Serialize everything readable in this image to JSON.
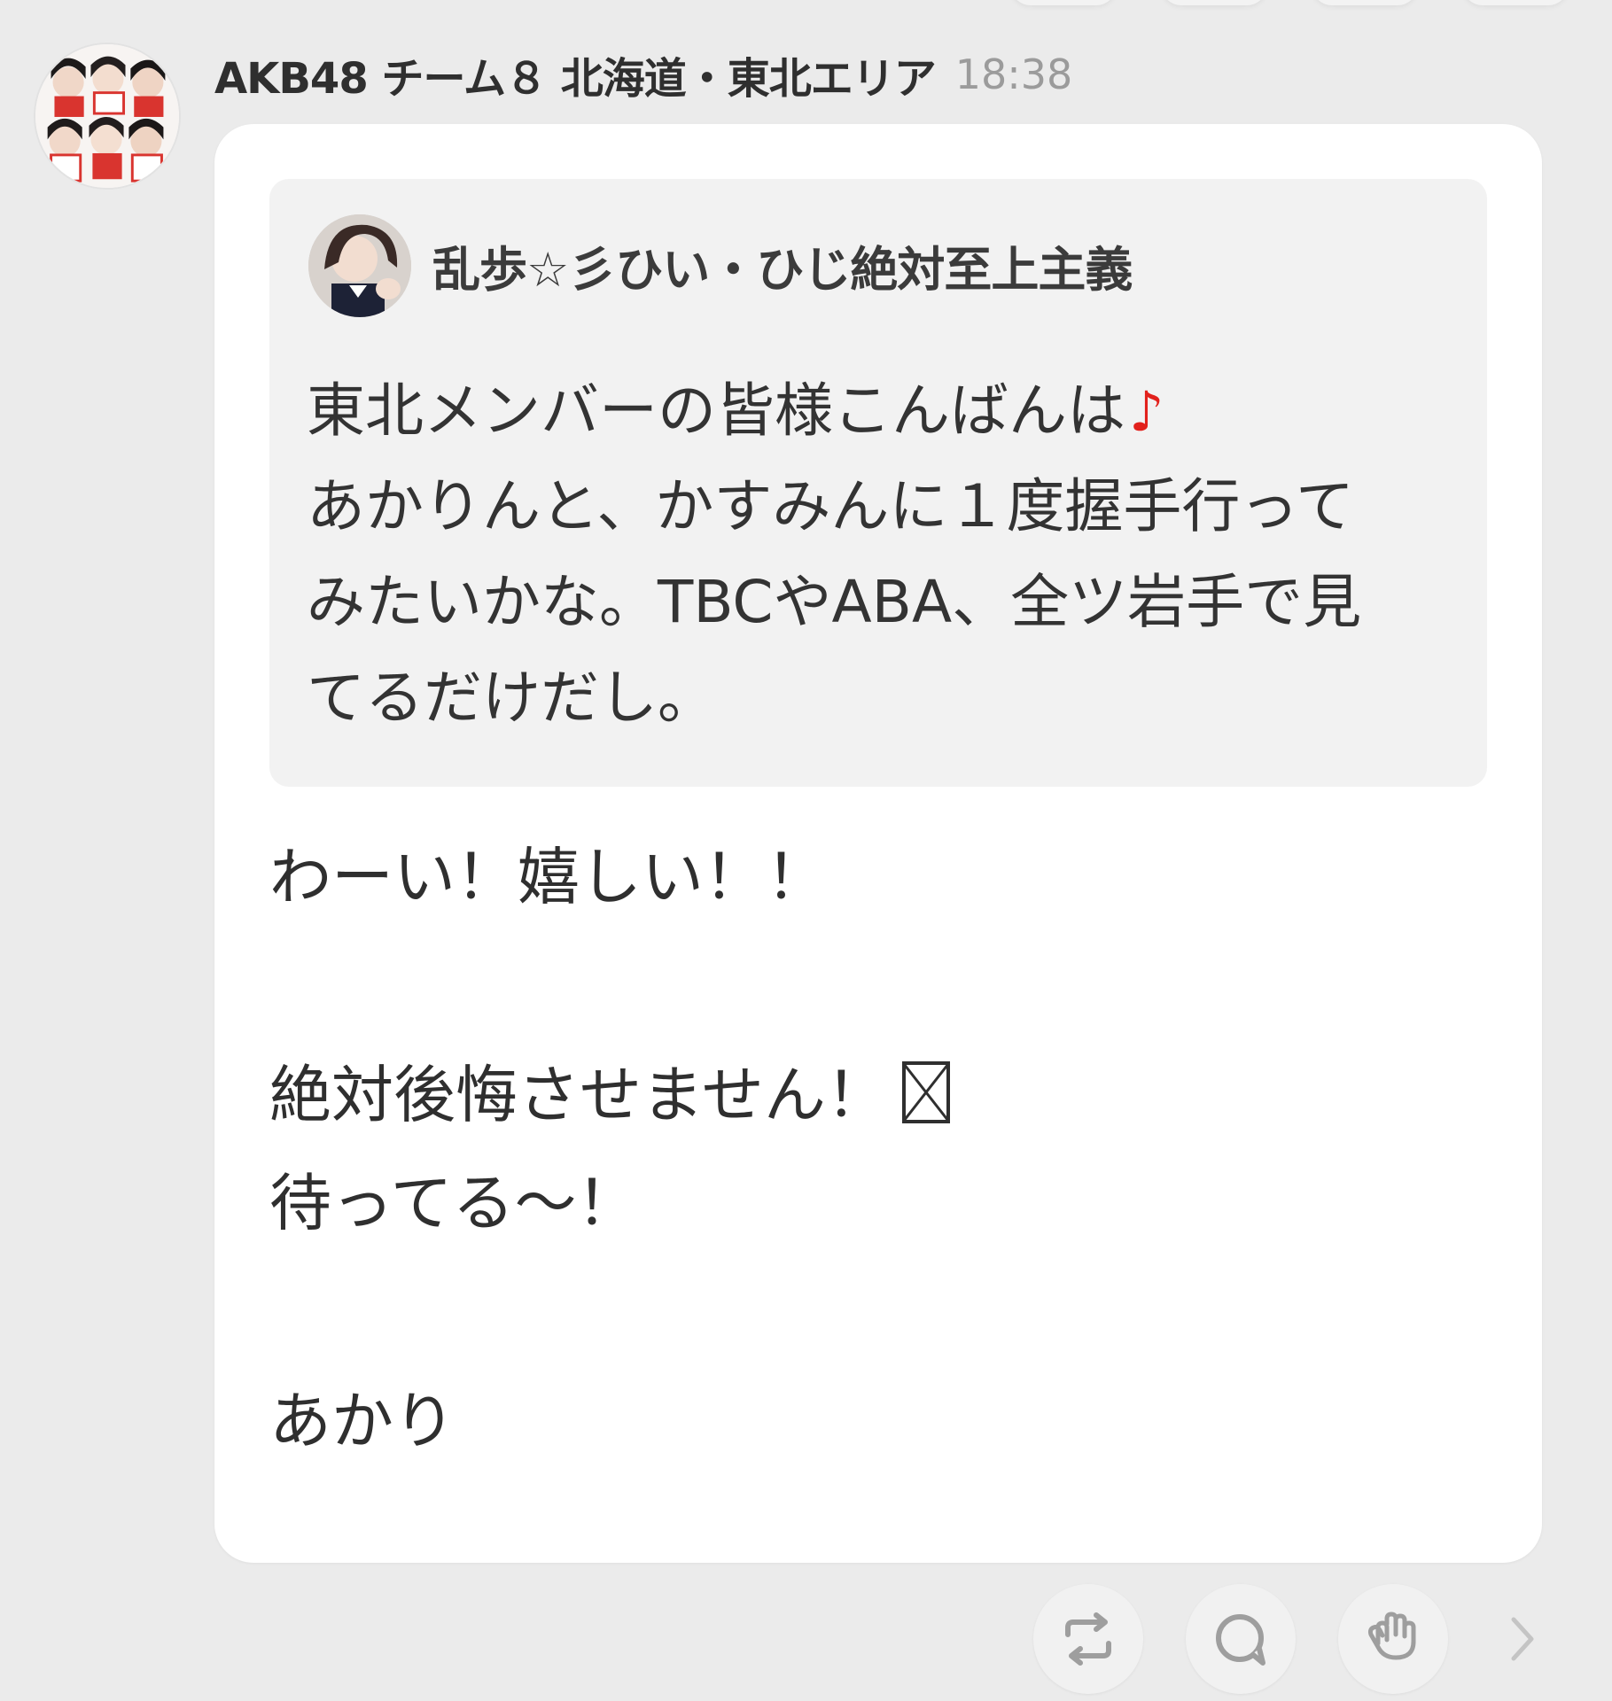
{
  "post": {
    "sender_name": "AKB48 チーム８ 北海道・東北エリア",
    "time": "18:38",
    "avatar_icon": "group-photo-avatar"
  },
  "quote": {
    "author": "乱歩☆彡ひい・ひじ絶対至上主義",
    "avatar_icon": "user-photo-avatar",
    "lines": [
      "東北メンバーの皆様こんばんは",
      "あかりんと、かすみんに１度握手行って",
      "みたいかな。TBCやABA、全ツ岩手で見",
      "てるだけだし。"
    ],
    "music_note": "♪",
    "music_note_color": "#e2211c"
  },
  "reply": {
    "lines": [
      "わーい！嬉しい！！",
      "",
      "絶対後悔させません！",
      "待ってる〜！",
      "",
      "あかり"
    ],
    "missing_glyph_icon": "missing-glyph-icon"
  },
  "actions": {
    "icons": [
      "repost-icon",
      "comment-icon",
      "hand-icon",
      "chevron-right-icon"
    ]
  },
  "colors": {
    "background": "#ebebeb",
    "bubble": "#ffffff",
    "quote_background": "#f2f2f2",
    "time_text": "#9b9b9b"
  }
}
